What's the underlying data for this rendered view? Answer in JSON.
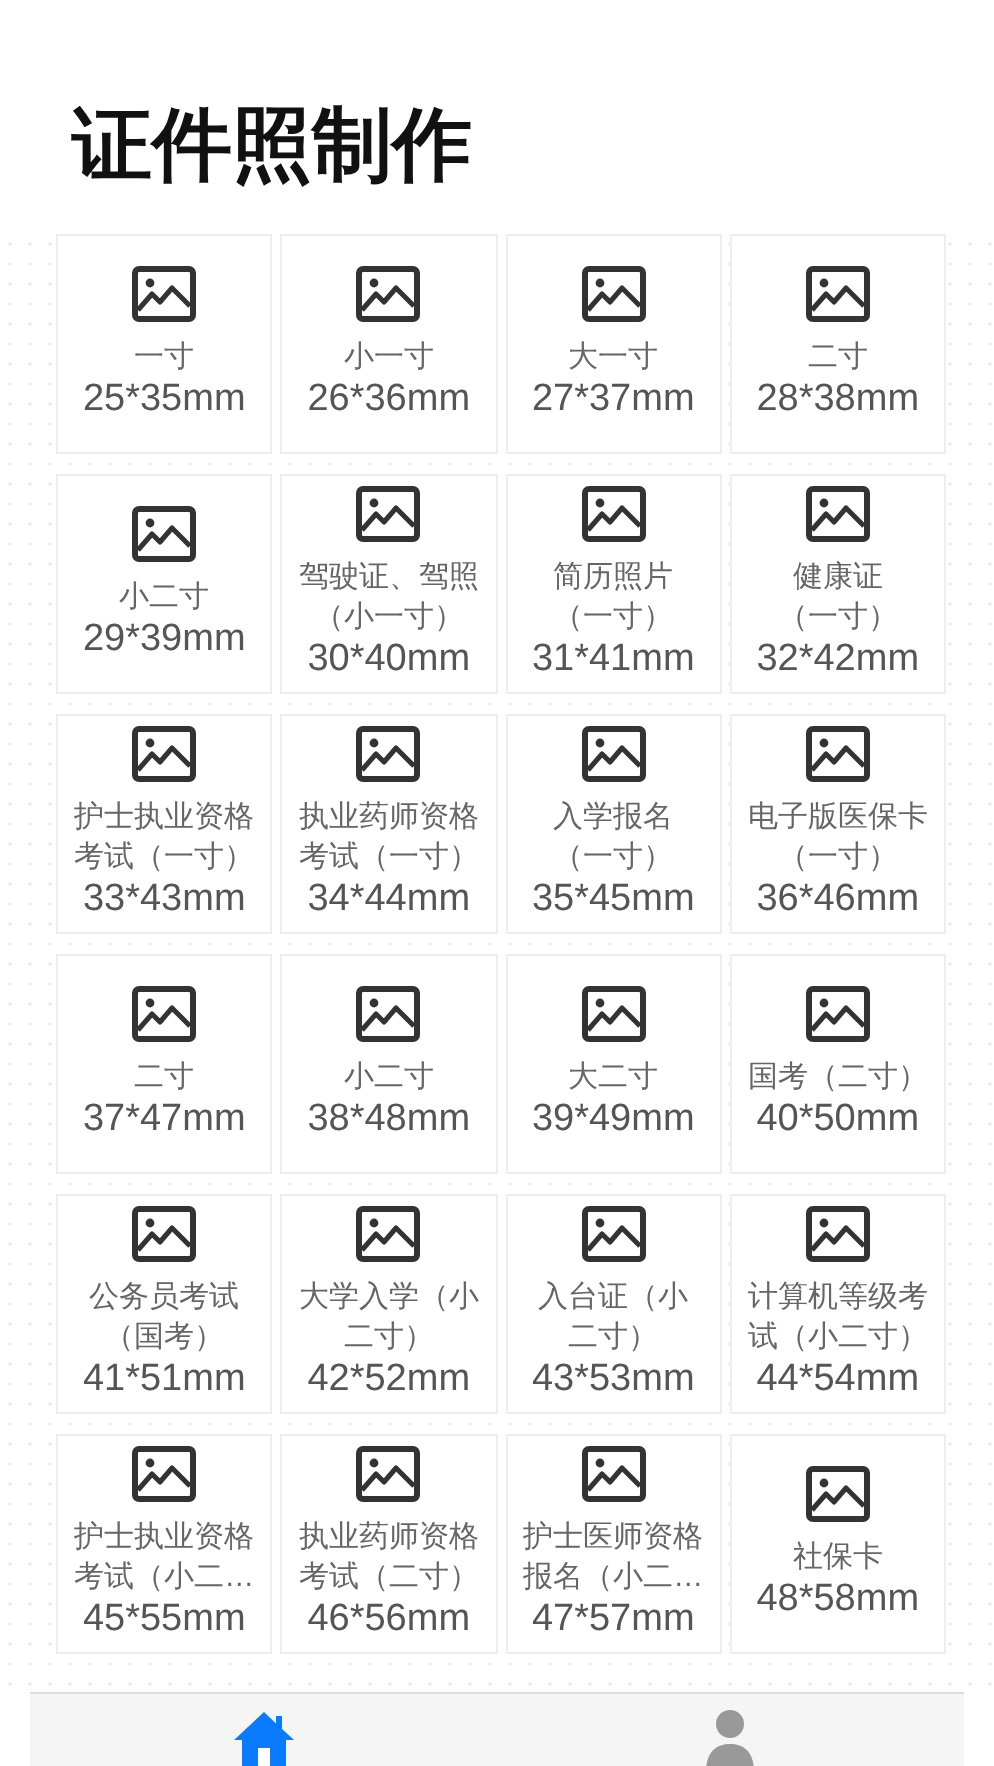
{
  "title": "证件照制作",
  "items": [
    {
      "name_lines": [
        "一寸"
      ],
      "size": "25*35mm"
    },
    {
      "name_lines": [
        "小一寸"
      ],
      "size": "26*36mm"
    },
    {
      "name_lines": [
        "大一寸"
      ],
      "size": "27*37mm"
    },
    {
      "name_lines": [
        "二寸"
      ],
      "size": "28*38mm"
    },
    {
      "name_lines": [
        "小二寸"
      ],
      "size": "29*39mm"
    },
    {
      "name_lines": [
        "驾驶证、驾照",
        "（小一寸）"
      ],
      "size": "30*40mm"
    },
    {
      "name_lines": [
        "简历照片",
        "（一寸）"
      ],
      "size": "31*41mm"
    },
    {
      "name_lines": [
        "健康证",
        "（一寸）"
      ],
      "size": "32*42mm"
    },
    {
      "name_lines": [
        "护士执业资格",
        "考试（一寸）"
      ],
      "size": "33*43mm"
    },
    {
      "name_lines": [
        "执业药师资格",
        "考试（一寸）"
      ],
      "size": "34*44mm"
    },
    {
      "name_lines": [
        "入学报名",
        "（一寸）"
      ],
      "size": "35*45mm"
    },
    {
      "name_lines": [
        "电子版医保卡",
        "（一寸）"
      ],
      "size": "36*46mm"
    },
    {
      "name_lines": [
        "二寸"
      ],
      "size": "37*47mm"
    },
    {
      "name_lines": [
        "小二寸"
      ],
      "size": "38*48mm"
    },
    {
      "name_lines": [
        "大二寸"
      ],
      "size": "39*49mm"
    },
    {
      "name_lines": [
        "国考（二寸）"
      ],
      "size": "40*50mm"
    },
    {
      "name_lines": [
        "公务员考试",
        "（国考）"
      ],
      "size": "41*51mm"
    },
    {
      "name_lines": [
        "大学入学（小",
        "二寸）"
      ],
      "size": "42*52mm"
    },
    {
      "name_lines": [
        "入台证（小",
        "二寸）"
      ],
      "size": "43*53mm"
    },
    {
      "name_lines": [
        "计算机等级考",
        "试（小二寸）"
      ],
      "size": "44*54mm"
    },
    {
      "name_lines": [
        "护士执业资格",
        "考试（小二…"
      ],
      "size": "45*55mm"
    },
    {
      "name_lines": [
        "执业药师资格",
        "考试（二寸）"
      ],
      "size": "46*56mm"
    },
    {
      "name_lines": [
        "护士医师资格",
        "报名（小二…"
      ],
      "size": "47*57mm"
    },
    {
      "name_lines": [
        "社保卡"
      ],
      "size": "48*58mm"
    }
  ],
  "tabs": [
    {
      "kind": "home",
      "selected": true
    },
    {
      "kind": "profile",
      "selected": false
    }
  ]
}
